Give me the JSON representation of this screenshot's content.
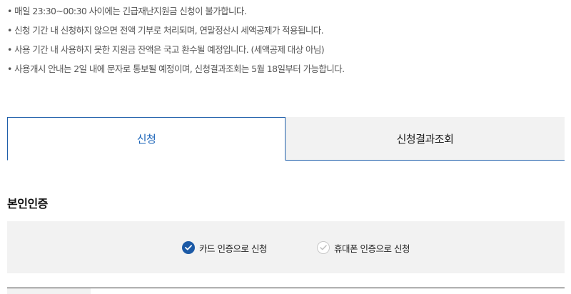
{
  "notices": [
    "• 매일 23:30~00:30 사이에는 긴급재난지원금 신청이 불가합니다.",
    "• 신청 기간 내 신청하지 않으면 전액 기부로 처리되며, 연말정산시 세액공제가 적용됩니다.",
    "• 사용 기간 내 사용하지 못한 지원금 잔액은 국고 환수될 예정입니다. (세액공제 대상 아님)",
    "• 사용개시 안내는 2일 내에 문자로 통보될 예정이며, 신청결과조회는 5월 18일부터 가능합니다."
  ],
  "tabs": {
    "apply_label": "신청",
    "result_label": "신청결과조회"
  },
  "auth": {
    "title": "본인인증",
    "card_option_label": "카드 인증으로 신청",
    "phone_option_label": "휴대폰 인증으로 신청",
    "selected": "card"
  },
  "colors": {
    "accent": "#1c5aa6",
    "tab_active_text": "#1a63b8",
    "panel_bg": "#f2f2f2"
  },
  "icons": {
    "checked": "check-circle-filled-icon",
    "unchecked": "check-circle-outline-icon"
  }
}
